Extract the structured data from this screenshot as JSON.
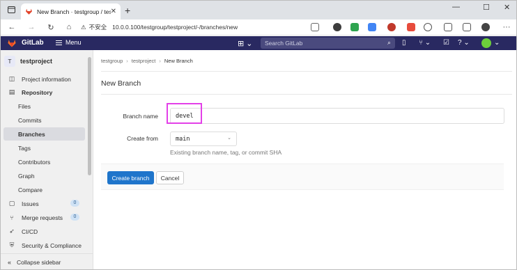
{
  "browser": {
    "tab_title": "New Branch · testgroup / testproje",
    "insecure_label": "不安全",
    "url": "10.0.0.100/testgroup/testproject/-/branches/new"
  },
  "header": {
    "brand": "GitLab",
    "menu_label": "Menu",
    "search_placeholder": "Search GitLab",
    "brand_color": "#292961"
  },
  "sidebar": {
    "project_initial": "T",
    "project_name": "testproject",
    "items": [
      {
        "label": "Project information",
        "icon": "info-icon"
      },
      {
        "label": "Repository",
        "icon": "book-icon"
      },
      {
        "label": "Files"
      },
      {
        "label": "Commits"
      },
      {
        "label": "Branches"
      },
      {
        "label": "Tags"
      },
      {
        "label": "Contributors"
      },
      {
        "label": "Graph"
      },
      {
        "label": "Compare"
      },
      {
        "label": "Issues",
        "icon": "issues-icon",
        "badge": "0"
      },
      {
        "label": "Merge requests",
        "icon": "merge-icon",
        "badge": "0"
      },
      {
        "label": "CI/CD",
        "icon": "rocket-icon"
      },
      {
        "label": "Security & Compliance",
        "icon": "shield-icon"
      }
    ],
    "collapse_label": "Collapse sidebar"
  },
  "breadcrumb": {
    "items": [
      "testgroup",
      "testproject",
      "New Branch"
    ]
  },
  "page": {
    "title": "New Branch",
    "branch_name_label": "Branch name",
    "branch_name_value": "devel",
    "create_from_label": "Create from",
    "create_from_value": "main",
    "help_text": "Existing branch name, tag, or commit SHA",
    "create_button": "Create branch",
    "cancel_button": "Cancel",
    "accent_color": "#1f75cb"
  }
}
